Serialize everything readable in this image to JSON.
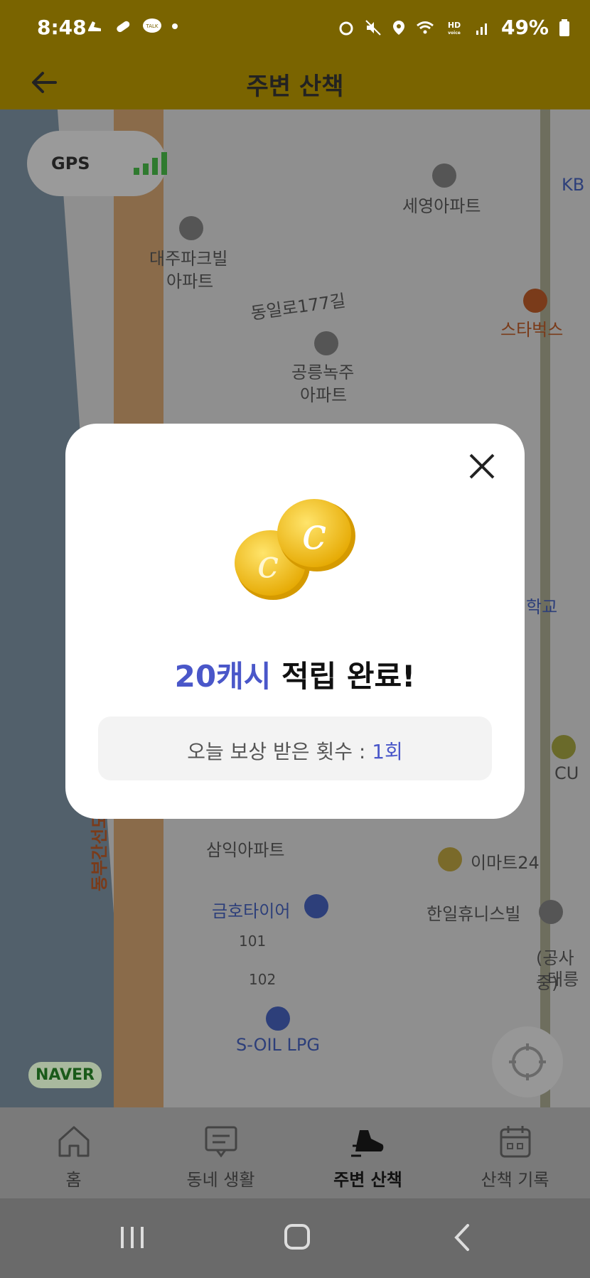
{
  "status_bar": {
    "time": "8:48",
    "battery": "49%",
    "icons": [
      "shoe-icon",
      "pill-icon",
      "talk-icon",
      "dot-icon",
      "alarm-icon",
      "mute-icon",
      "location-icon",
      "wifi-icon",
      "hd-voice-icon",
      "signal-icon",
      "battery-icon"
    ]
  },
  "header": {
    "title": "주변 산책",
    "back_icon": "arrow-left-icon"
  },
  "map": {
    "gps_label": "GPS",
    "naver_logo": "NAVER",
    "labels": {
      "apt1": "세영아파트",
      "apt2": "대주파크빌",
      "apt2b": "아파트",
      "road": "동일로177길",
      "apt3": "공릉녹주",
      "apt3b": "아파트",
      "starbucks": "스타벅스",
      "kb": "KB",
      "school": "학교",
      "cu": "CU",
      "apt4": "삼익아파트",
      "tire": "금호타이어",
      "emart": "이마트24",
      "hanil": "한일휴니스빌",
      "n101": "101",
      "n102": "102",
      "lpg": "S-OIL LPG",
      "expressway": "동부간선도로",
      "gongsa": "(공사중)",
      "taereung": "태릉"
    }
  },
  "modal": {
    "amount": "20캐시",
    "message": "적립 완료!",
    "count_label": "오늘 보상 받은 횟수 : ",
    "count_value": "1회",
    "accent_color": "#4a57c9"
  },
  "tabs": [
    {
      "label": "홈",
      "icon": "home-icon",
      "active": false
    },
    {
      "label": "동네 생활",
      "icon": "chat-board-icon",
      "active": false
    },
    {
      "label": "주변 산책",
      "icon": "walking-shoe-icon",
      "active": true
    },
    {
      "label": "산책 기록",
      "icon": "calendar-icon",
      "active": false
    }
  ]
}
